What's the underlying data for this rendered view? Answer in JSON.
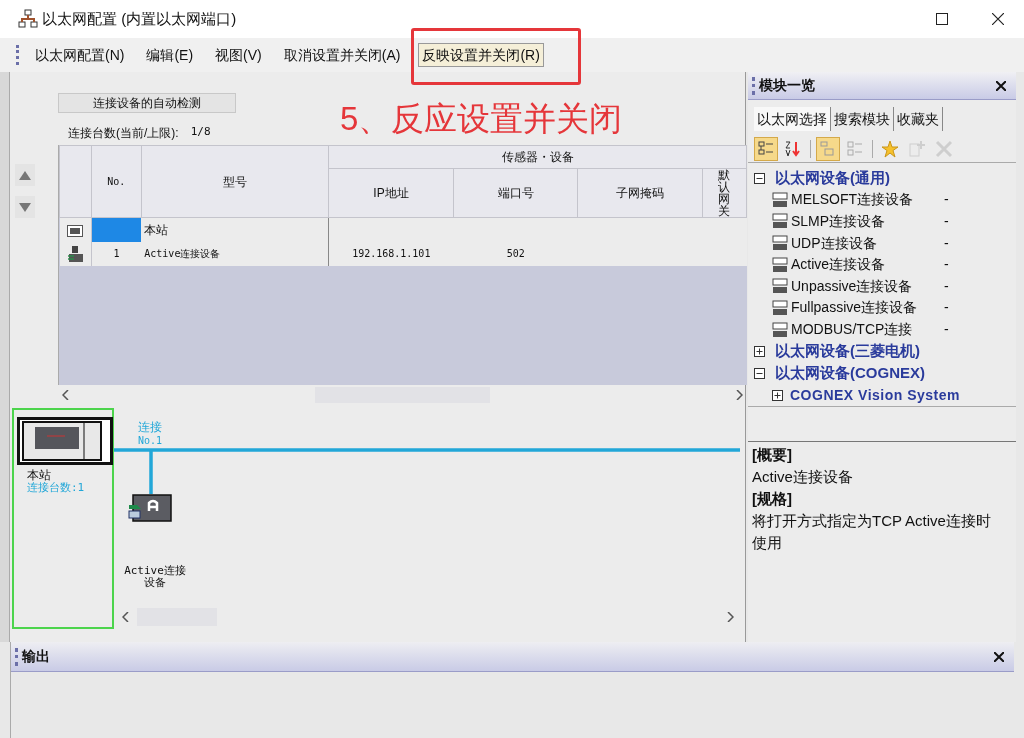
{
  "window": {
    "title": "以太网配置 (内置以太网端口)"
  },
  "menu": [
    {
      "label": "以太网配置(N)",
      "selected": false
    },
    {
      "label": "编辑(E)",
      "selected": false
    },
    {
      "label": "视图(V)",
      "selected": false
    },
    {
      "label": "取消设置并关闭(A)",
      "selected": false
    },
    {
      "label": "反映设置并关闭(R)",
      "selected": true
    }
  ],
  "annotation": {
    "text": "5、反应设置并关闭"
  },
  "auto_detect_button": "连接设备的自动检测",
  "connection_count": {
    "label": "连接台数(当前/上限):",
    "value": "1/8"
  },
  "table": {
    "group_header": "传感器・设备",
    "columns": [
      "No.",
      "型号",
      "IP地址",
      "端口号",
      "子网掩码",
      "默认网关"
    ],
    "rows": [
      {
        "kind": "station",
        "no": "",
        "model": "本站",
        "ip": "",
        "port": "",
        "selected": true
      },
      {
        "kind": "active",
        "no": "1",
        "model": "Active连接设备",
        "ip": "192.168.1.101",
        "port": "502",
        "selected": false
      }
    ]
  },
  "diagram": {
    "station": {
      "label": "本站",
      "count": "连接台数:1",
      "selected": true
    },
    "connection": {
      "label": "连接",
      "no": "No.1"
    },
    "device": {
      "label": "Active连接设备"
    }
  },
  "module_panel": {
    "title": "模块一览",
    "tabs": [
      {
        "label": "以太网选择",
        "selected": true
      },
      {
        "label": "搜索模块",
        "selected": false
      },
      {
        "label": "收藏夹",
        "selected": false
      }
    ],
    "toolbar": [
      {
        "kind": "category",
        "selected": true,
        "disabled": false
      },
      {
        "kind": "sort",
        "selected": false,
        "disabled": false
      },
      {
        "kind": "expand",
        "selected": true,
        "disabled": false
      },
      {
        "kind": "collapse",
        "selected": false,
        "disabled": false
      },
      {
        "kind": "star",
        "selected": false,
        "disabled": false
      },
      {
        "kind": "add",
        "selected": false,
        "disabled": true
      },
      {
        "kind": "delete",
        "selected": false,
        "disabled": true
      }
    ],
    "tree": [
      {
        "label": "以太网设备(通用)",
        "expanded": true,
        "children": [
          {
            "label": "MELSOFT连接设备",
            "note": "-"
          },
          {
            "label": "SLMP连接设备",
            "note": "-"
          },
          {
            "label": "UDP连接设备",
            "note": "-"
          },
          {
            "label": "Active连接设备",
            "note": "-"
          },
          {
            "label": "Unpassive连接设备",
            "note": "-"
          },
          {
            "label": "Fullpassive连接设备",
            "note": "-"
          },
          {
            "label": "MODBUS/TCP连接",
            "note": "-"
          }
        ]
      },
      {
        "label": "以太网设备(三菱电机)",
        "expanded": false
      },
      {
        "label": "以太网设备(COGNEX)",
        "expanded": true,
        "children": [
          {
            "label": "COGNEX Vision System",
            "expanded": false
          }
        ]
      }
    ]
  },
  "description": [
    {
      "heading": "[概要]",
      "text": "Active连接设备"
    },
    {
      "heading": "[规格]",
      "text": "将打开方式指定为TCP Active连接时使用"
    }
  ],
  "output": {
    "title": "输出"
  }
}
